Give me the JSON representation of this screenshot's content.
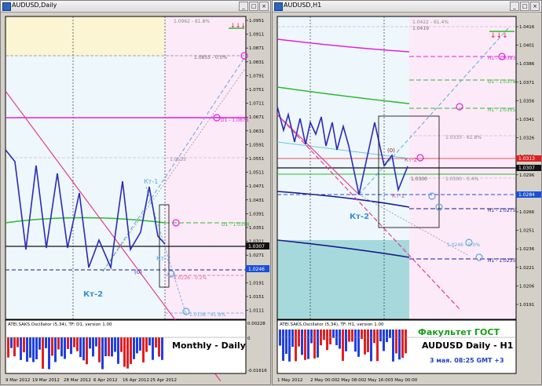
{
  "left": {
    "title": "AUDUSD,Daily",
    "price_labels": [
      "1.0951",
      "1.0911",
      "1.0871",
      "1.0831",
      "1.0791",
      "1.0751",
      "1.0711",
      "1.0671",
      "1.0631",
      "1.0591",
      "1.0551",
      "1.0511",
      "1.0471",
      "1.0431",
      "1.0391",
      "1.0351",
      "1.0311",
      "1.0271",
      "1.0231",
      "1.0191",
      "1.0151",
      "1.0111"
    ],
    "current_price": "1.0307",
    "blue_price": "1.0246",
    "level_labels": {
      "top": "1.0962 - 61.8%",
      "upper": "1.0855 - 0.0%",
      "d1": "D1 - 1.0678",
      "mid": "1.0535",
      "d1b": "D1 - 1.0378",
      "low": "1.0226 - 0.2%",
      "bottom": "1.0138 - 61.8%"
    },
    "wave_labels": {
      "kt1": "Кт-1",
      "kt2": "Кт-2",
      "kt2b": "Кт-2",
      "zero": "(0)"
    },
    "indicator_title": "ATEI.SAKS.Oscillator (5,34), TF: D1, version 1.00",
    "indicator_labels": [
      "0.00228",
      "0",
      "-0.01616"
    ],
    "overlay_text": "Monthly - Daily",
    "time_labels": [
      "9 Mar 2012",
      "19 Mar 2012",
      "28 Mar 2012",
      "6 Apr 2012",
      "16 Apr 2012",
      "25 Apr 2012"
    ]
  },
  "right": {
    "title": "AUDUSD,H1",
    "price_labels": [
      "1.0416",
      "1.0401",
      "1.0386",
      "1.0371",
      "1.0356",
      "1.0341",
      "1.0326",
      "1.0311",
      "1.0296",
      "1.0281",
      "1.0266",
      "1.0251",
      "1.0236",
      "1.0221",
      "1.0206",
      "1.0191"
    ],
    "red_price": "1.0313",
    "current_price": "1.0307",
    "blue_price": "1.0284",
    "level_labels": {
      "top": "1.0422 - 61.4%",
      "top2": "1.0419",
      "h1a": "H1 - 1.0393",
      "d1": "D1 - 1.0378",
      "h1b": "H1 - 1.0355",
      "fib1": "1.0333 - 61.8%",
      "fib2": "1.0300",
      "fib3": "1.0300 - 0.4%",
      "h1c": "H1 - 1.0275",
      "fib4": "1.0246 - 0.0%",
      "h1d": "H1 - 1.0235"
    },
    "wave_labels": {
      "kt1": "Кт-1",
      "kt2": "Кт-2",
      "kt2b": "Кт-2",
      "zero": "(0)"
    },
    "indicator_title": "ATEI.SAKS.Oscillator (5,34), TF: H1, version 1.00",
    "overlay_line1": "Факультет ГОСТ",
    "overlay_line2": "AUDUSD Daily - H1",
    "overlay_line3": "3 мая. 08:25 GMT +3",
    "time_labels": [
      "1 May 2012",
      "2 May 00:00",
      "2 May 08:00",
      "2 May 16:00",
      "3 May 00:00"
    ]
  },
  "colors": {
    "bg_blue": "#eef7fc",
    "bg_pink": "#fdeaf8",
    "bg_yellow": "#fbf5d4",
    "bg_teal": "#a6d9dc",
    "magenta": "#e020e0",
    "green": "#2db82d",
    "navy": "#1a1a8c",
    "zigzag": "#2a2ab8",
    "pink": "#e63c8c",
    "light_blue": "#5aa8e0",
    "red": "#e02020",
    "green_text": "#18a018"
  }
}
